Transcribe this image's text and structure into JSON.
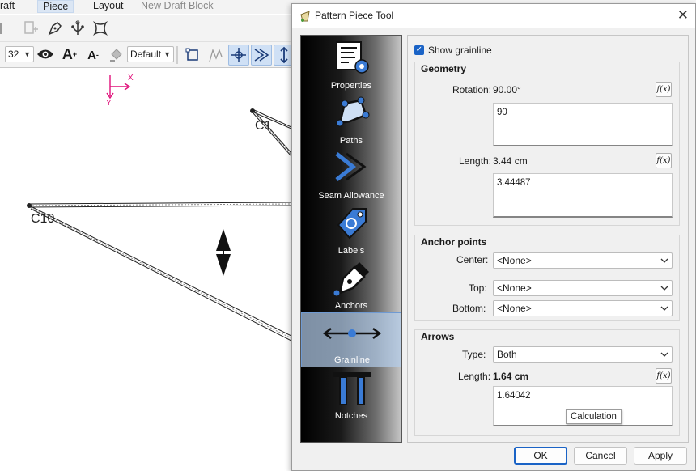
{
  "app": {
    "menu": [
      "raft",
      "Piece",
      "Layout"
    ],
    "active_menu": "Piece",
    "title": "New Draft Block",
    "toolbar": {
      "size_value": "32",
      "line_style": "Default"
    },
    "canvas": {
      "axis_x": "X",
      "axis_y": "Y",
      "labels": [
        "C1",
        "C10"
      ]
    }
  },
  "dialog": {
    "title": "Pattern Piece Tool",
    "close": "✕",
    "sidebar": [
      {
        "label": "Properties",
        "icon": "properties-icon"
      },
      {
        "label": "Paths",
        "icon": "paths-icon"
      },
      {
        "label": "Seam Allowance",
        "icon": "seam-allowance-icon"
      },
      {
        "label": "Labels",
        "icon": "labels-icon"
      },
      {
        "label": "Anchors",
        "icon": "anchors-icon"
      },
      {
        "label": "Grainline",
        "icon": "grainline-icon"
      },
      {
        "label": "Notches",
        "icon": "notches-icon"
      }
    ],
    "selected_tab": "Grainline",
    "show_grainline": {
      "label": "Show grainline",
      "checked": true
    },
    "geometry": {
      "title": "Geometry",
      "rotation_label": "Rotation:",
      "rotation_value": "90.00°",
      "rotation_formula": "90",
      "length_label": "Length:",
      "length_value": "3.44 cm",
      "length_formula": "3.44487"
    },
    "anchor_points": {
      "title": "Anchor points",
      "center_label": "Center:",
      "center_value": "<None>",
      "top_label": "Top:",
      "top_value": "<None>",
      "bottom_label": "Bottom:",
      "bottom_value": "<None>"
    },
    "arrows": {
      "title": "Arrows",
      "type_label": "Type:",
      "type_value": "Both",
      "length_label": "Length:",
      "length_value": "1.64 cm",
      "length_formula": "1.64042",
      "tooltip": "Calculation"
    },
    "fx_label": "f(x)",
    "buttons": {
      "ok": "OK",
      "cancel": "Cancel",
      "apply": "Apply"
    }
  },
  "colors": {
    "accent": "#1a63c6",
    "axis_magenta": "#e0107a"
  }
}
